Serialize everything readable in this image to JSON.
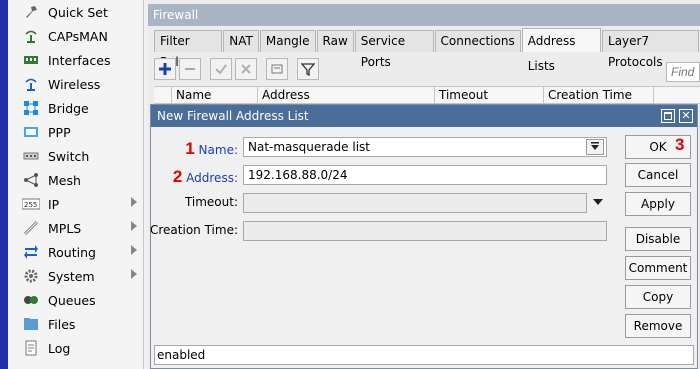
{
  "sidebar": {
    "items": [
      {
        "label": "Quick Set",
        "icon": "quick-set-icon"
      },
      {
        "label": "CAPsMAN",
        "icon": "capsman-icon"
      },
      {
        "label": "Interfaces",
        "icon": "interfaces-icon"
      },
      {
        "label": "Wireless",
        "icon": "wireless-icon"
      },
      {
        "label": "Bridge",
        "icon": "bridge-icon"
      },
      {
        "label": "PPP",
        "icon": "ppp-icon"
      },
      {
        "label": "Switch",
        "icon": "switch-icon"
      },
      {
        "label": "Mesh",
        "icon": "mesh-icon"
      },
      {
        "label": "IP",
        "icon": "ip-icon"
      },
      {
        "label": "MPLS",
        "icon": "mpls-icon"
      },
      {
        "label": "Routing",
        "icon": "routing-icon"
      },
      {
        "label": "System",
        "icon": "system-icon"
      },
      {
        "label": "Queues",
        "icon": "queues-icon"
      },
      {
        "label": "Files",
        "icon": "files-icon"
      },
      {
        "label": "Log",
        "icon": "log-icon"
      }
    ]
  },
  "firewall": {
    "title": "Firewall",
    "tabs": [
      "Filter Rules",
      "NAT",
      "Mangle",
      "Raw",
      "Service Ports",
      "Connections",
      "Address Lists",
      "Layer7 Protocols"
    ],
    "active_tab": "Address Lists",
    "find_placeholder": "Find",
    "columns": [
      "Name",
      "Address",
      "Timeout",
      "Creation Time"
    ]
  },
  "dialog": {
    "title": "New Firewall Address List",
    "fields": {
      "name": {
        "label": "Name:",
        "value": "Nat-masquerade list"
      },
      "address": {
        "label": "Address:",
        "value": "192.168.88.0/24"
      },
      "timeout": {
        "label": "Timeout:",
        "value": ""
      },
      "creation_time": {
        "label": "Creation Time:",
        "value": ""
      }
    },
    "buttons": {
      "ok": "OK",
      "cancel": "Cancel",
      "apply": "Apply",
      "disable": "Disable",
      "comment": "Comment",
      "copy": "Copy",
      "remove": "Remove"
    },
    "status": "enabled"
  },
  "annotations": {
    "name_marker": "1",
    "address_marker": "2",
    "ok_marker": "3"
  },
  "colors": {
    "rail": "#1e2fa8",
    "dialog_title": "#4a6d99",
    "firewall_title": "#a9b5c4",
    "marker": "#e00000",
    "label_blue": "#1a3fb0"
  }
}
